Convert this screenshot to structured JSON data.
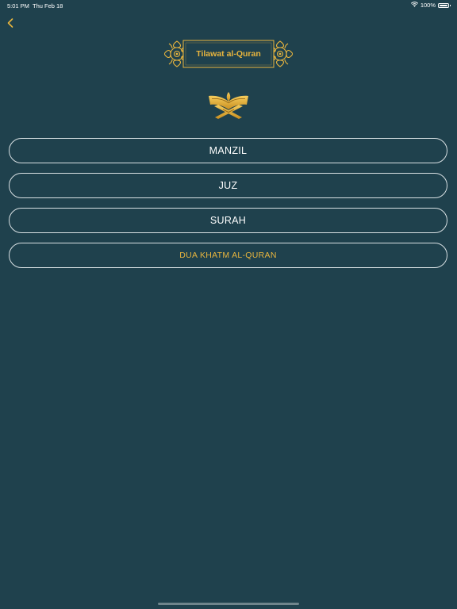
{
  "status_bar": {
    "time": "5:01 PM",
    "date": "Thu Feb 18",
    "battery": "100%"
  },
  "header": {
    "title": "Tilawat al-Quran"
  },
  "menu": {
    "items": [
      {
        "label": "MANZIL"
      },
      {
        "label": "JUZ"
      },
      {
        "label": "SURAH"
      },
      {
        "label": "DUA KHATM AL-QURAN"
      }
    ]
  },
  "colors": {
    "background": "#1f414d",
    "accent_gold": "#e8b53e",
    "button_border": "#d8e0e3"
  },
  "icons": {
    "back": "chevron-left-icon",
    "wifi": "wifi-icon",
    "battery": "battery-icon",
    "quran": "quran-stand-icon",
    "ornament": "ornament-icon"
  }
}
